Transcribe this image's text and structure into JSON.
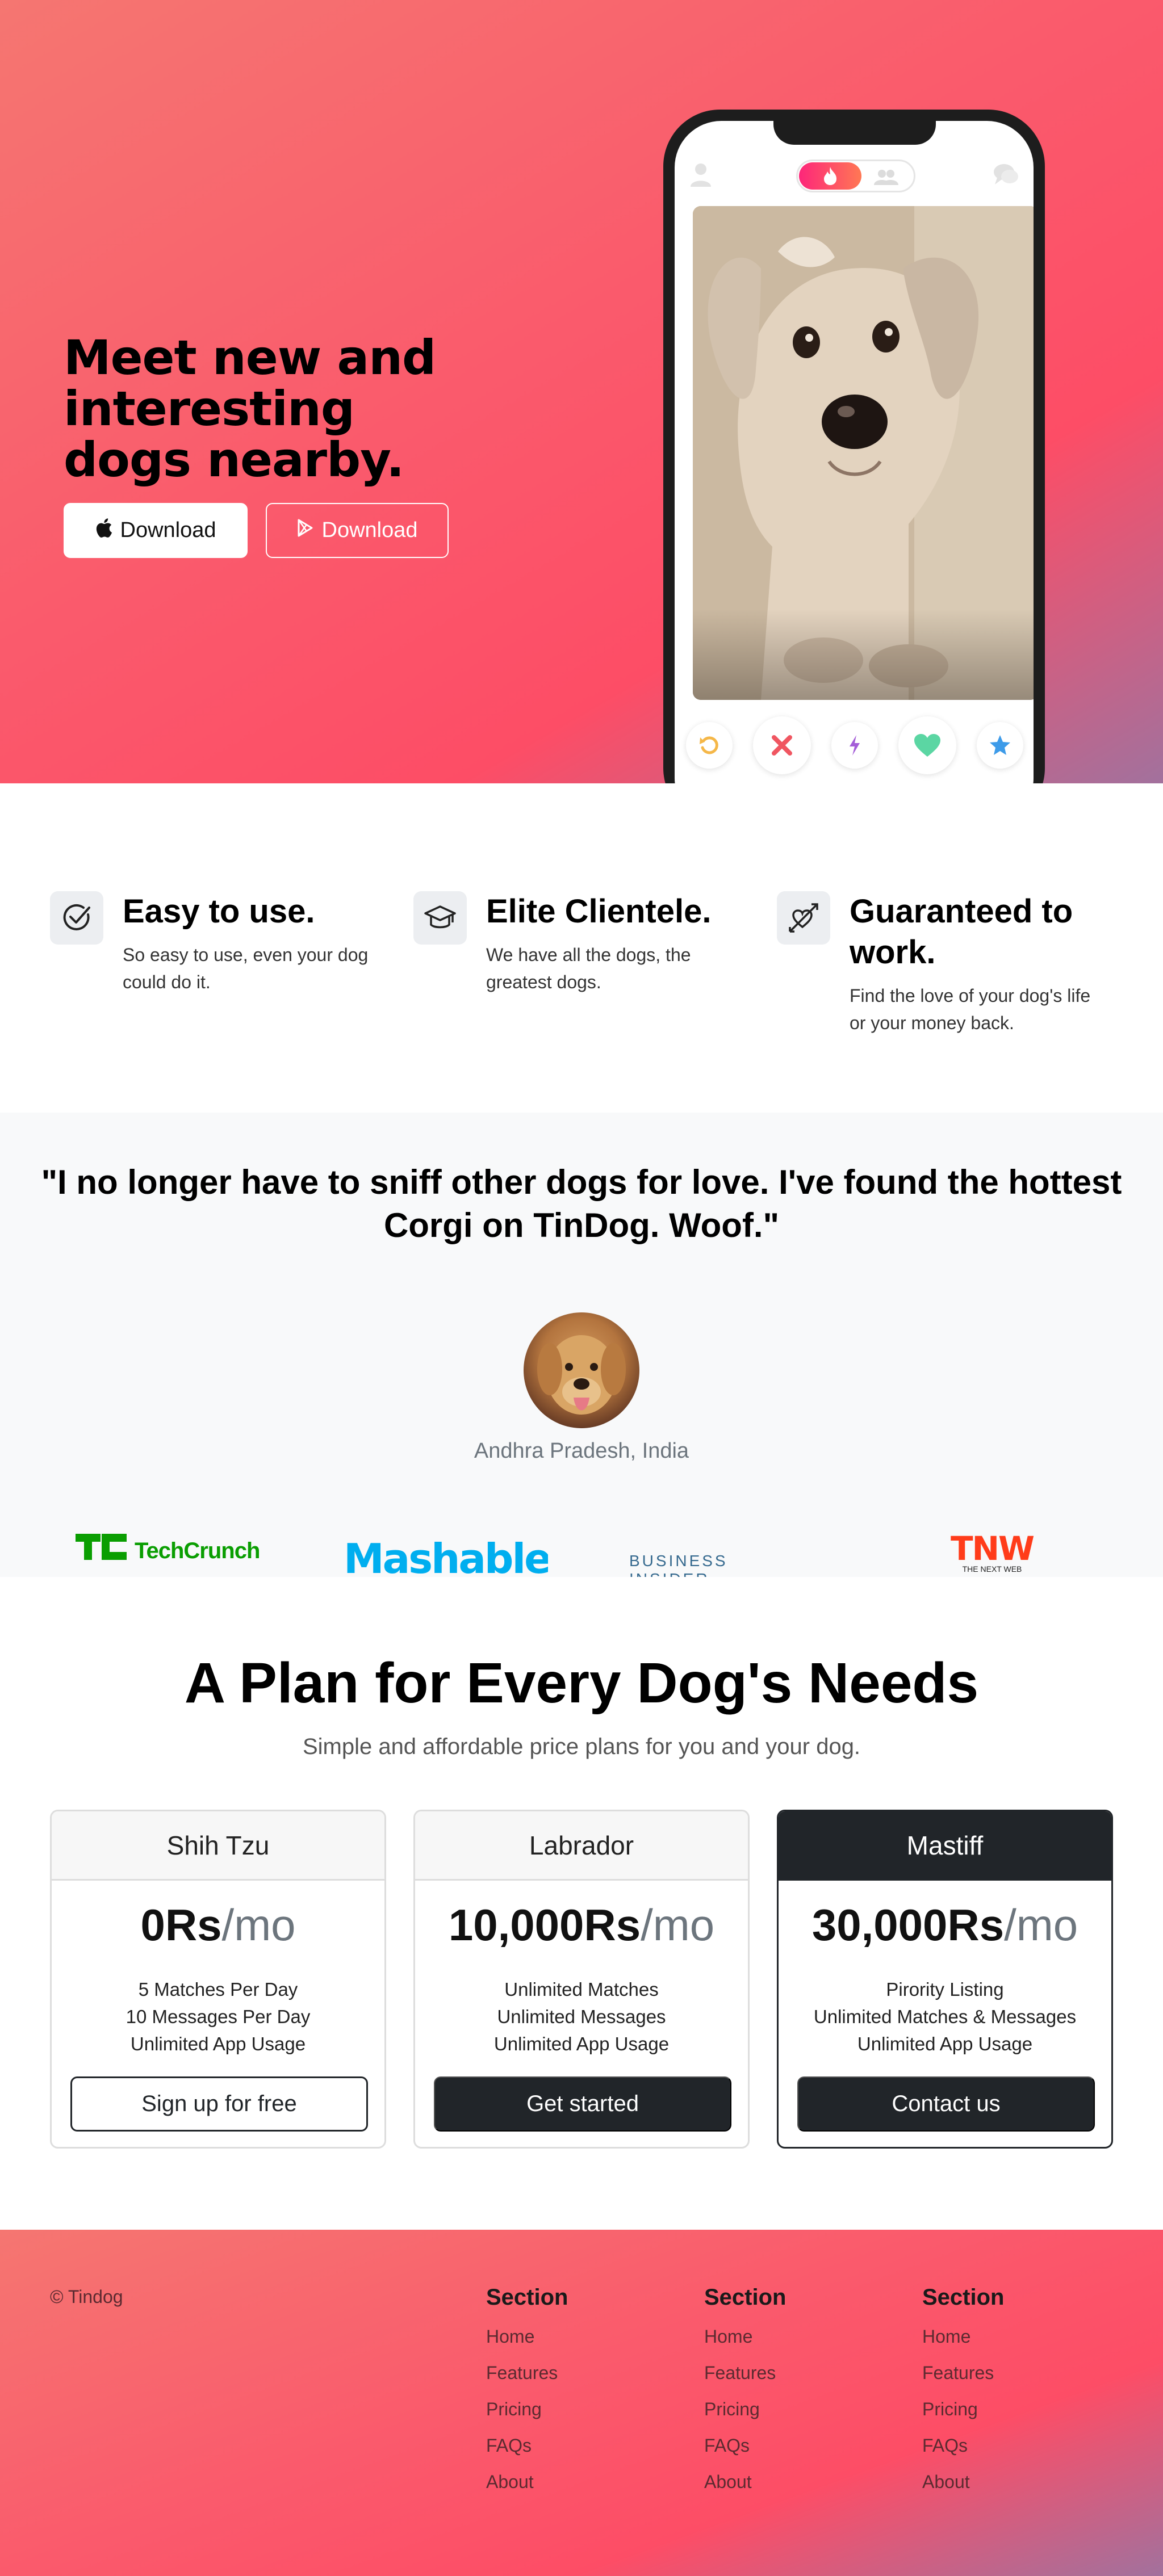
{
  "hero": {
    "title": "Meet new and interesting dogs nearby.",
    "apple_button": "Download",
    "play_button": "Download"
  },
  "phone": {
    "icons": [
      "user-icon",
      "flame-icon",
      "people-icon",
      "chat-icon"
    ],
    "action_icons": [
      "rewind-icon",
      "nope-icon",
      "boost-icon",
      "like-icon",
      "superlike-icon"
    ]
  },
  "features": [
    {
      "icon": "check-circle-icon",
      "title": "Easy to use.",
      "text": "So easy to use, even your dog could do it."
    },
    {
      "icon": "graduation-cap-icon",
      "title": "Elite Clientele.",
      "text": "We have all the dogs, the greatest dogs."
    },
    {
      "icon": "heart-arrow-icon",
      "title": "Guaranteed to work.",
      "text": "Find the love of your dog's life or your money back."
    }
  ],
  "testimonial": {
    "quote": "\"I no longer have to sniff other dogs for love. I've found the hottest Corgi on TinDog. Woof.\"",
    "location": "Andhra Pradesh, India"
  },
  "press": {
    "techcrunch_mark": "TC",
    "techcrunch": "TechCrunch",
    "mashable": "Mashable",
    "business_insider": "BUSINESS INSIDER",
    "tnw": "TNW",
    "tnw_sub": "THE NEXT WEB"
  },
  "pricing": {
    "title": "A Plan for Every Dog's Needs",
    "subtitle": "Simple and affordable price plans for you and your dog.",
    "plans": [
      {
        "name": "Shih Tzu",
        "amount": "0Rs",
        "period": "/mo",
        "features": [
          "5 Matches Per Day",
          "10 Messages Per Day",
          "Unlimited App Usage"
        ],
        "button": "Sign up for free"
      },
      {
        "name": "Labrador",
        "amount": "10,000Rs",
        "period": "/mo",
        "features": [
          "Unlimited Matches",
          "Unlimited Messages",
          "Unlimited App Usage"
        ],
        "button": "Get started"
      },
      {
        "name": "Mastiff",
        "amount": "30,000Rs",
        "period": "/mo",
        "features": [
          "Pirority Listing",
          "Unlimited Matches & Messages",
          "Unlimited App Usage"
        ],
        "button": "Contact us"
      }
    ]
  },
  "footer": {
    "copyright": "© Tindog",
    "columns": [
      {
        "heading": "Section",
        "links": [
          "Home",
          "Features",
          "Pricing",
          "FAQs",
          "About"
        ]
      },
      {
        "heading": "Section",
        "links": [
          "Home",
          "Features",
          "Pricing",
          "FAQs",
          "About"
        ]
      },
      {
        "heading": "Section",
        "links": [
          "Home",
          "Features",
          "Pricing",
          "FAQs",
          "About"
        ]
      }
    ]
  },
  "colors": {
    "gradient_start": "#f57671",
    "gradient_mid": "#fd4d66",
    "gradient_end": "#a2719d",
    "dark": "#212529",
    "techcrunch_green": "#0a9e01",
    "mashable_blue": "#00aeef",
    "tnw_red": "#ff3c1a"
  }
}
